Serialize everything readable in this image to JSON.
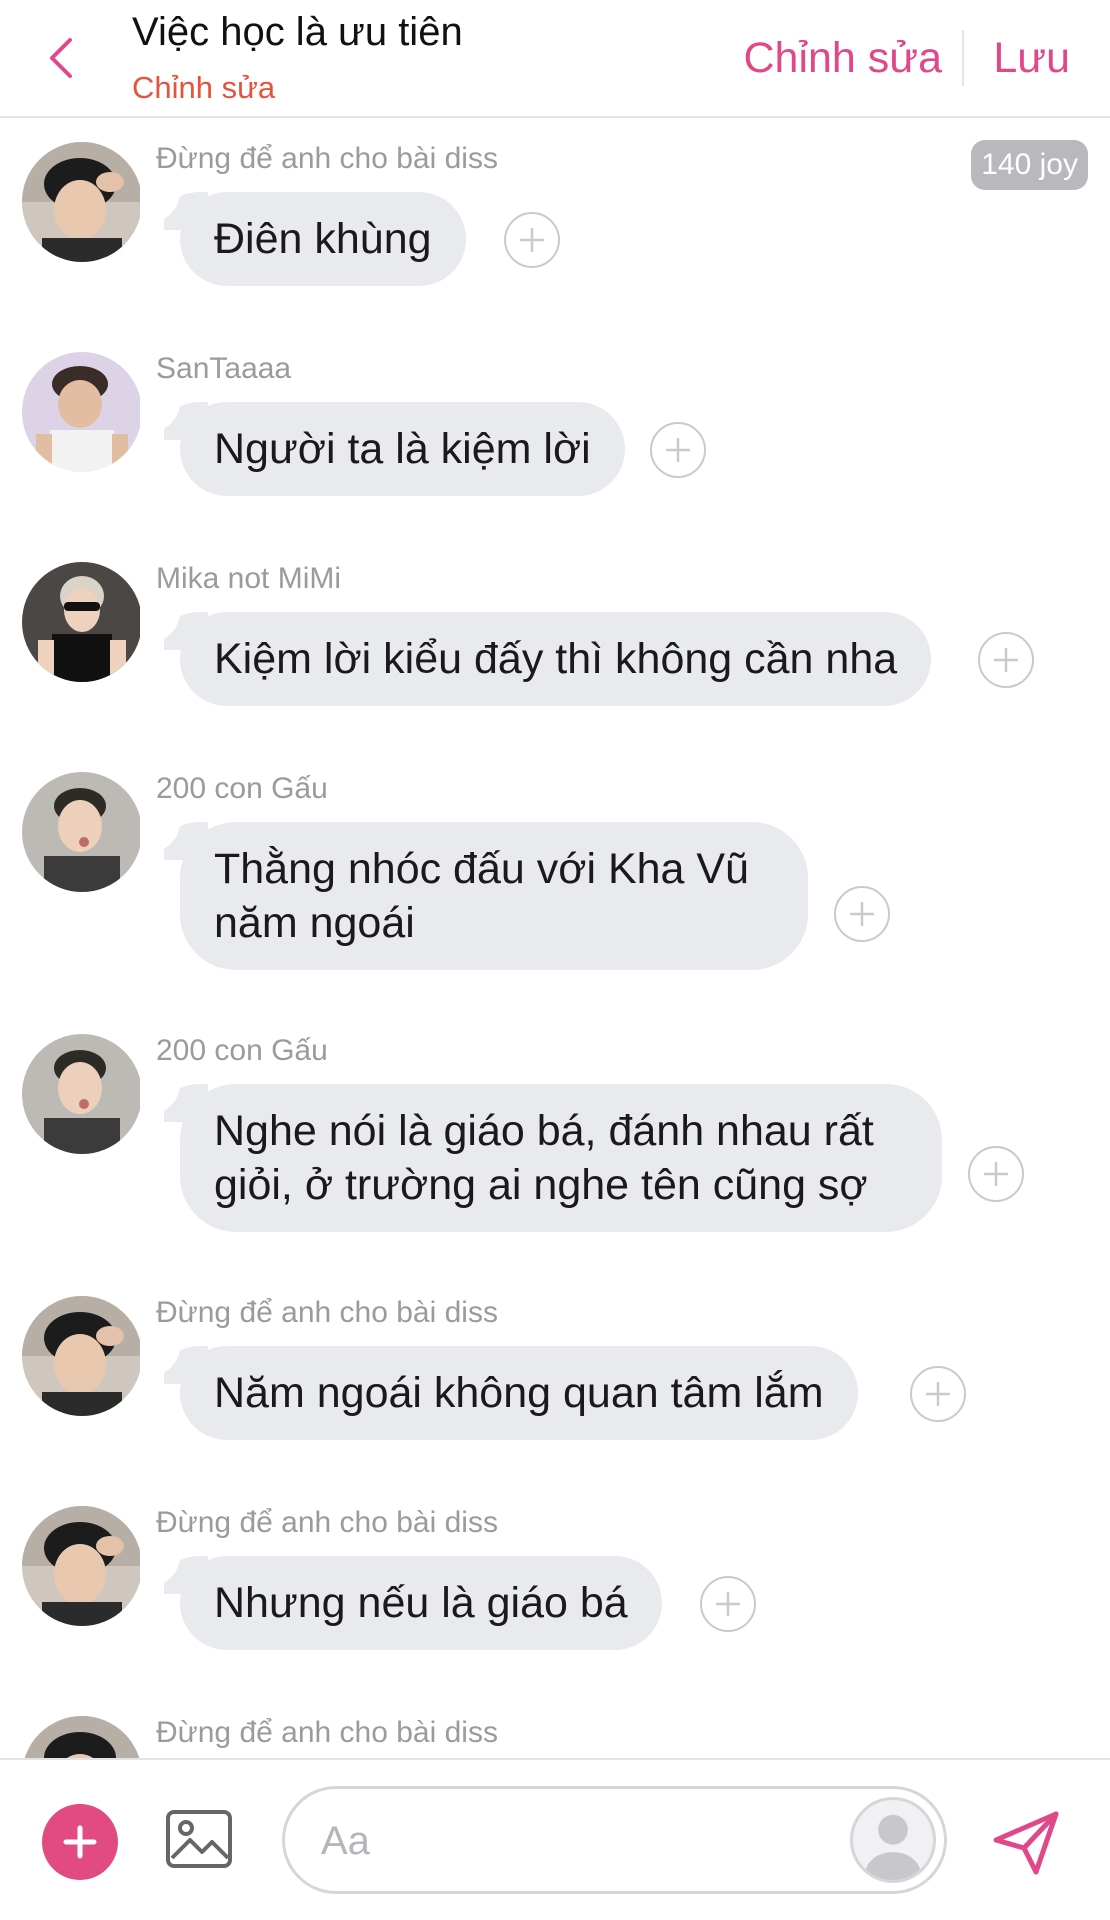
{
  "header": {
    "title": "Việc học là ưu tiên",
    "subtitle": "Chỉnh sửa",
    "edit_label": "Chỉnh sửa",
    "save_label": "Lưu"
  },
  "badge": "140 joy",
  "messages": [
    {
      "sender": "Đừng để anh cho bài diss",
      "text": "Điên khùng",
      "avatar": "boy-hand-on-head"
    },
    {
      "sender": "SanTaaaa",
      "text": "Người ta là kiệm lời",
      "avatar": "boy-white-tank"
    },
    {
      "sender": "Mika not MiMi",
      "text": "Kiệm lời kiểu đấy thì không cần nha",
      "avatar": "boy-sunglasses"
    },
    {
      "sender": "200 con Gấu",
      "text": "Thằng nhóc đấu với Kha Vũ năm ngoái",
      "avatar": "boy-pout"
    },
    {
      "sender": "200 con Gấu",
      "text": "Nghe nói là giáo bá, đánh nhau rất giỏi, ở trường ai nghe tên cũng sợ",
      "avatar": "boy-pout"
    },
    {
      "sender": "Đừng để anh cho bài diss",
      "text": "Năm ngoái không quan tâm lắm",
      "avatar": "boy-hand-on-head"
    },
    {
      "sender": "Đừng để anh cho bài diss",
      "text": "Nhưng nếu là giáo bá",
      "avatar": "boy-hand-on-head"
    },
    {
      "sender": "Đừng để anh cho bài diss",
      "text": "",
      "avatar": "boy-hand-on-head"
    }
  ],
  "composer": {
    "placeholder": "Aa"
  },
  "icons": {
    "back": "chevron-left-icon",
    "add": "plus-icon",
    "image": "image-icon",
    "send": "send-icon",
    "react": "add-reaction-icon",
    "user": "user-avatar-icon"
  },
  "colors": {
    "accent": "#e1488a",
    "subtitle": "#e5533e",
    "bubble": "#e9eaee",
    "badge": "#b8b8bd"
  }
}
